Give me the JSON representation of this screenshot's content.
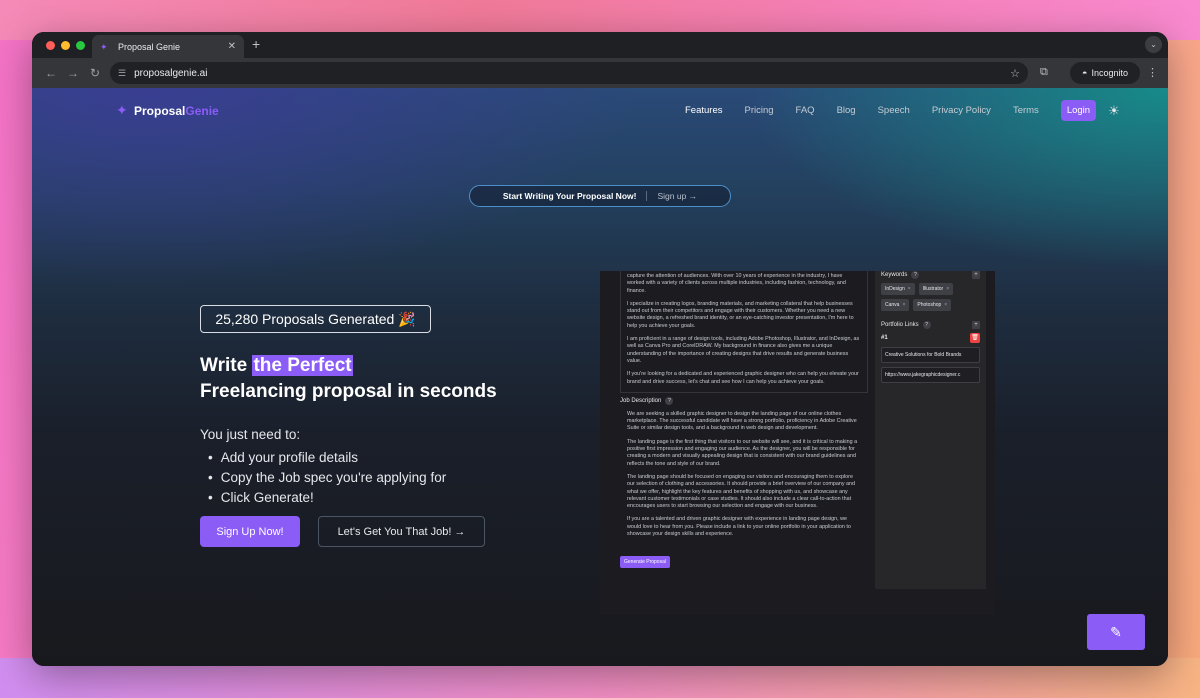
{
  "browser": {
    "tab_title": "Proposal Genie",
    "url": "proposalgenie.ai",
    "incognito_label": "Incognito"
  },
  "site": {
    "logo_word1": "Proposal",
    "logo_word2": "Genie",
    "nav": [
      {
        "label": "Features"
      },
      {
        "label": "Pricing"
      },
      {
        "label": "FAQ"
      },
      {
        "label": "Blog"
      },
      {
        "label": "Speech"
      },
      {
        "label": "Privacy Policy"
      },
      {
        "label": "Terms"
      }
    ],
    "login_label": "Login"
  },
  "banner": {
    "text": "Start Writing Your Proposal Now!",
    "link": "Sign up →"
  },
  "hero": {
    "counter": "25,280 Proposals Generated 🎉",
    "headline_prefix": "Write ",
    "headline_highlight": "the Perfect",
    "headline_line2": "Freelancing proposal in seconds",
    "intro": "You just need to:",
    "steps": [
      "Add your profile details",
      "Copy the Job spec you're applying for",
      "Click Generate!"
    ],
    "signup_label": "Sign Up Now!",
    "job_label": "Let's Get You That Job! →"
  },
  "demo": {
    "profile_paragraphs": [
      "capture the attention of audiences. With over 10 years of experience in the industry, I have worked with a variety of clients across multiple industries, including fashion, technology, and finance.",
      "I specialize in creating logos, branding materials, and marketing collateral that help businesses stand out from their competitors and engage with their customers. Whether you need a new website design, a refreshed brand identity, or an eye-catching investor presentation, I'm here to help you achieve your goals.",
      "I am proficient in a range of design tools, including Adobe Photoshop, Illustrator, and InDesign, as well as Canva Pro and CorelDRAW. My background in finance also gives me a unique understanding of the importance of creating designs that drive results and generate business value.",
      "If you're looking for a dedicated and experienced graphic designer who can help you elevate your brand and drive success, let's chat and see how I can help you achieve your goals."
    ],
    "job_description_label": "Job Description",
    "job_paragraphs": [
      "We are seeking a skilled graphic designer to design the landing page of our online clothes marketplace. The successful candidate will have a strong portfolio, proficiency in Adobe Creative Suite or similar design tools, and a background in web design and development.",
      "The landing page is the first thing that visitors to our website will see, and it is critical to making a positive first impression and engaging our audience. As the designer, you will be responsible for creating a modern and visually appealing design that is consistent with our brand guidelines and reflects the tone and style of our brand.",
      "The landing page should be focused on engaging our visitors and encouraging them to explore our selection of clothing and accessories. It should provide a brief overview of our company and what we offer, highlight the key features and benefits of shopping with us, and showcase any relevant customer testimonials or case studies. It should also include a clear call-to-action that encourages users to start browsing our selection and engage with our business.",
      "If you are a talented and driven graphic designer with experience in landing page design, we would love to hear from you. Please include a link to your online portfolio in your application to showcase your design skills and experience."
    ],
    "generate_label": "Generate Proposal",
    "keywords_label": "Keywords",
    "keywords": [
      "InDesign",
      "Illustrator",
      "Canva",
      "Photoshop"
    ],
    "portfolio_label": "Portfolio Links",
    "portfolio_num": "#1",
    "portfolio_title": "Creative Solutions for Bold Brands",
    "portfolio_url": "https://www.jakegraphicdesigner.c"
  }
}
